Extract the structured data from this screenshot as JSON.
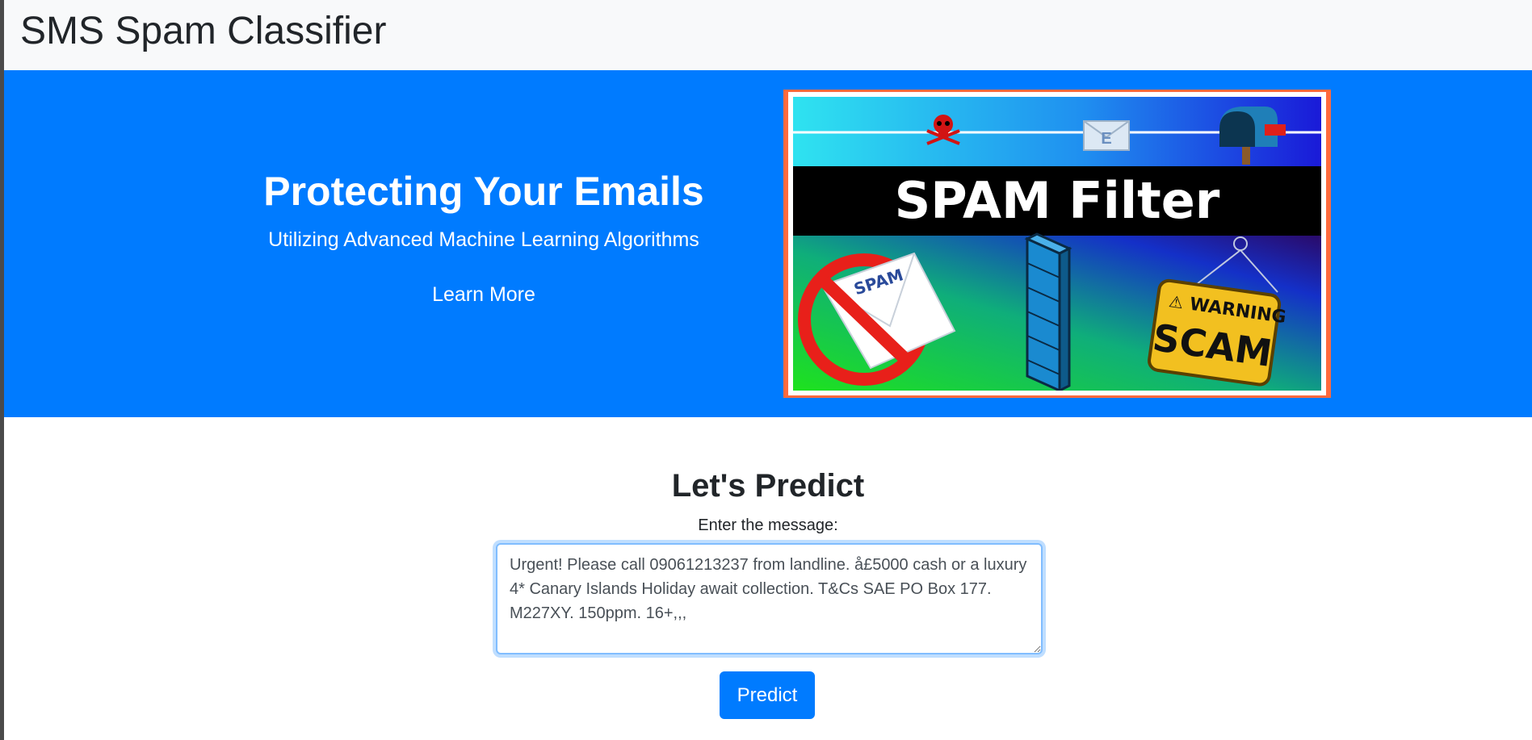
{
  "navbar": {
    "brand": "SMS Spam Classifier"
  },
  "hero": {
    "title": "Protecting Your Emails",
    "subtitle": "Utilizing Advanced Machine Learning Algorithms",
    "link_label": "Learn More",
    "banner": {
      "headline": "SPAM Filter",
      "envelope_label": "SPAM",
      "mail_letter": "E",
      "warning_label": "WARNING",
      "scam_label": "SCAM",
      "warning_glyph": "⚠"
    }
  },
  "predict": {
    "title": "Let's Predict",
    "field_label": "Enter the message:",
    "message_value": "Urgent! Please call 09061213237 from landline. å£5000 cash or a luxury 4* Canary Islands Holiday await collection. T&Cs SAE PO Box 177. M227XY. 150ppm. 16+,,,",
    "button_label": "Predict"
  },
  "colors": {
    "accent": "#007bff",
    "navbar_bg": "#f8f9fa",
    "banner_frame": "#ff6a3d"
  }
}
